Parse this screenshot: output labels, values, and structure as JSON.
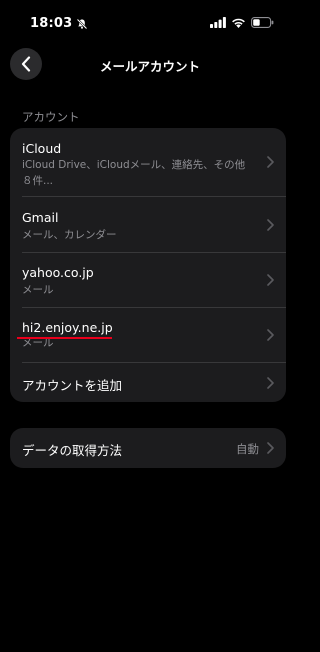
{
  "status_bar": {
    "time": "18:03",
    "icons": [
      "bell-slash-icon",
      "signal-icon",
      "wifi-icon",
      "battery-icon"
    ]
  },
  "nav": {
    "title": "メールアカウント",
    "back_icon": "chevron-left-icon"
  },
  "accounts": {
    "header": "アカウント",
    "items": [
      {
        "title": "iCloud",
        "subtitle": "iCloud Drive、iCloudメール、連絡先、その他８件..."
      },
      {
        "title": "Gmail",
        "subtitle": "メール、カレンダー"
      },
      {
        "title": "yahoo.co.jp",
        "subtitle": "メール"
      },
      {
        "title": "hi2.enjoy.ne.jp",
        "subtitle": "メール"
      },
      {
        "title": "アカウントを追加"
      }
    ]
  },
  "fetch": {
    "label": "データの取得方法",
    "value": "自動"
  },
  "colors": {
    "background": "#000000",
    "cell": "#1c1c1e",
    "secondary_text": "#8e8e93",
    "chevron": "#5a5a5e",
    "annotation": "#e8001c"
  }
}
